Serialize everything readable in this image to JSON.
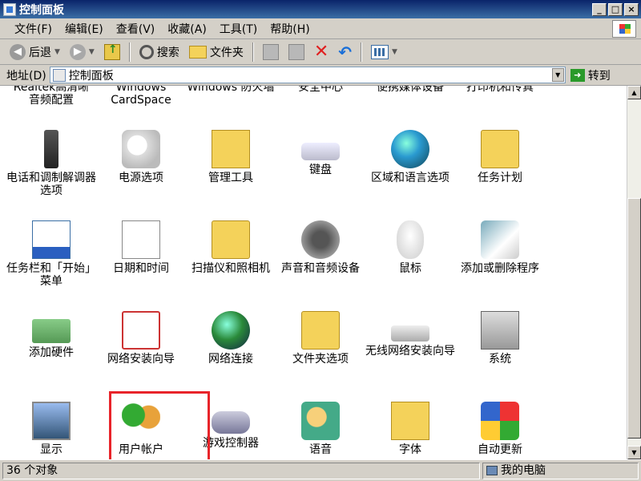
{
  "window": {
    "title": "控制面板",
    "buttons": [
      "_",
      "□",
      "×"
    ]
  },
  "menubar": {
    "items": [
      "文件(F)",
      "编辑(E)",
      "查看(V)",
      "收藏(A)",
      "工具(T)",
      "帮助(H)"
    ]
  },
  "toolbar": {
    "back_label": "后退",
    "search_label": "搜索",
    "folders_label": "文件夹"
  },
  "address": {
    "label": "地址(D)",
    "value": "控制面板",
    "goto_label": "转到"
  },
  "cut_top_items": [
    {
      "label": "Realtek高清晰\n音频配置"
    },
    {
      "label": "Windows\nCardSpace"
    },
    {
      "label": "Windows 防火墙"
    },
    {
      "label": "安全中心"
    },
    {
      "label": "便携媒体设备"
    },
    {
      "label": "打印机和传真"
    }
  ],
  "items": [
    {
      "label": "电话和调制解调器选项",
      "icon": "phone-modem-icon"
    },
    {
      "label": "电源选项",
      "icon": "power-options-icon"
    },
    {
      "label": "管理工具",
      "icon": "admin-tools-icon"
    },
    {
      "label": "键盘",
      "icon": "keyboard-icon"
    },
    {
      "label": "区域和语言选项",
      "icon": "globe-icon"
    },
    {
      "label": "任务计划",
      "icon": "scheduled-tasks-icon"
    },
    {
      "label": "任务栏和「开始」菜单",
      "icon": "taskbar-icon"
    },
    {
      "label": "日期和时间",
      "icon": "calendar-clock-icon"
    },
    {
      "label": "扫描仪和照相机",
      "icon": "scanner-camera-icon"
    },
    {
      "label": "声音和音频设备",
      "icon": "speaker-icon"
    },
    {
      "label": "鼠标",
      "icon": "mouse-icon"
    },
    {
      "label": "添加或删除程序",
      "icon": "add-remove-programs-icon"
    },
    {
      "label": "添加硬件",
      "icon": "add-hardware-icon"
    },
    {
      "label": "网络安装向导",
      "icon": "network-wizard-icon"
    },
    {
      "label": "网络连接",
      "icon": "network-connections-icon"
    },
    {
      "label": "文件夹选项",
      "icon": "folder-options-icon"
    },
    {
      "label": "无线网络安装向导",
      "icon": "wireless-wizard-icon"
    },
    {
      "label": "系统",
      "icon": "system-icon"
    },
    {
      "label": "显示",
      "icon": "display-icon"
    },
    {
      "label": "用户帐户",
      "icon": "user-accounts-icon"
    },
    {
      "label": "游戏控制器",
      "icon": "game-controller-icon"
    },
    {
      "label": "语音",
      "icon": "speech-icon"
    },
    {
      "label": "字体",
      "icon": "fonts-icon"
    },
    {
      "label": "自动更新",
      "icon": "windows-update-icon"
    }
  ],
  "status": {
    "left": "36 个对象",
    "right": "我的电脑"
  },
  "accent": {
    "titlebar": "#0a246a",
    "highlight": "#e8242a"
  }
}
